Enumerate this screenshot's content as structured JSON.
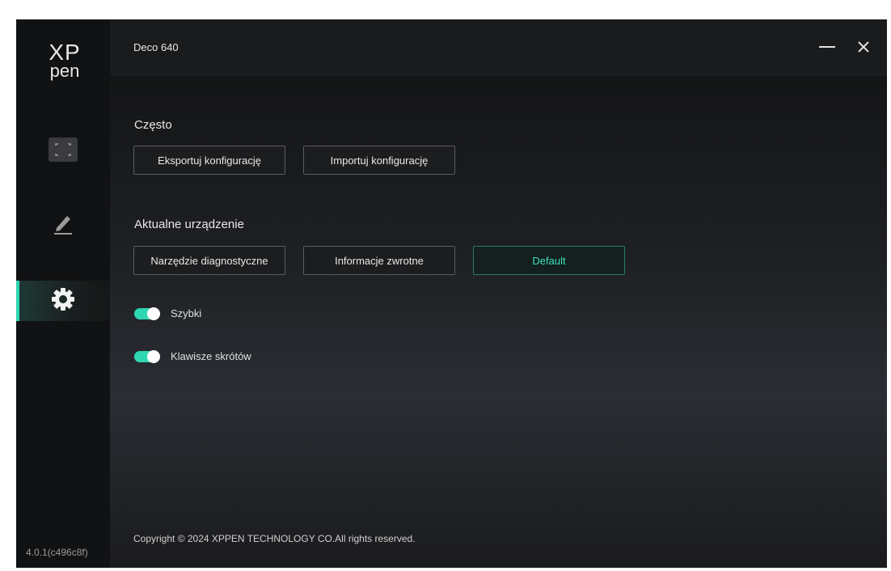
{
  "app": {
    "logo_top": "XP",
    "logo_bottom": "pen",
    "version": "4.0.1(c496c8f)",
    "title": "Deco 640"
  },
  "sidebar": {
    "items": [
      {
        "icon": "work-area-icon",
        "active": false
      },
      {
        "icon": "pen-icon",
        "active": false
      },
      {
        "icon": "gear-icon",
        "active": true
      }
    ]
  },
  "window_controls": {
    "minimize": "—",
    "close": "✕"
  },
  "sections": {
    "often": {
      "title": "Często",
      "export_label": "Eksportuj konfigurację",
      "import_label": "Importuj konfigurację"
    },
    "device": {
      "title": "Aktualne urządzenie",
      "diagnostic_label": "Narzędzie diagnostyczne",
      "feedback_label": "Informacje zwrotne",
      "default_label": "Default"
    }
  },
  "toggles": {
    "fast": {
      "label": "Szybki",
      "on": true
    },
    "shortcuts": {
      "label": "Klawisze skrótów",
      "on": true
    }
  },
  "footer": {
    "copyright": "Copyright © 2024  XPPEN TECHNOLOGY CO.All rights reserved."
  },
  "colors": {
    "accent": "#2fd6b2",
    "background": "#151617"
  }
}
